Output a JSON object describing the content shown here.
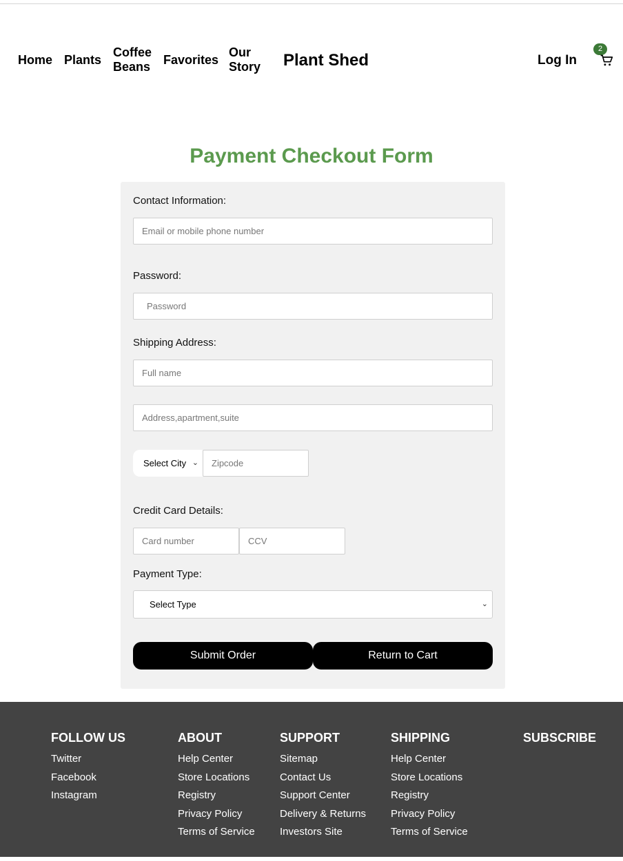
{
  "header": {
    "nav": [
      "Home",
      "Plants",
      "Coffee\nBeans",
      "Favorites",
      "Our\nStory"
    ],
    "brand": "Plant Shed",
    "login": "Log In",
    "cart_count": "2",
    "cart_icon": "shopping-cart-icon"
  },
  "form": {
    "title": "Payment Checkout Form",
    "contact_label": "Contact Information:",
    "contact_placeholder": "Email or mobile phone number",
    "password_label": "Password:",
    "password_placeholder": "Password",
    "shipping_label": "Shipping Address:",
    "fullname_placeholder": "Full name",
    "address_placeholder": "Address,apartment,suite",
    "city_select": "Select City",
    "zipcode_placeholder": "Zipcode",
    "card_label": "Credit Card Details:",
    "card_placeholder": "Card number",
    "ccv_placeholder": "CCV",
    "payment_label": "Payment Type:",
    "payment_select": "Select Type",
    "submit_label": "Submit Order",
    "return_label": "Return to Cart"
  },
  "footer": {
    "columns": [
      {
        "title": "FOLLOW US",
        "links": [
          "Twitter",
          "Facebook",
          "Instagram"
        ]
      },
      {
        "title": "ABOUT",
        "links": [
          "Help Center",
          "Store Locations",
          "Registry",
          "Privacy Policy",
          "Terms of Service"
        ]
      },
      {
        "title": "SUPPORT",
        "links": [
          "Sitemap",
          "Contact Us",
          "Support Center",
          "Delivery & Returns",
          "Investors Site"
        ]
      },
      {
        "title": "SHIPPING",
        "links": [
          "Help Center",
          "Store Locations",
          "Registry",
          "Privacy Policy",
          "Terms of Service"
        ]
      },
      {
        "title": "SUBSCRIBE",
        "links": []
      }
    ]
  },
  "colors": {
    "accent": "#5b9a4e",
    "badge": "#3c7a37",
    "footer": "#434343",
    "panel": "#f1f1f1"
  }
}
